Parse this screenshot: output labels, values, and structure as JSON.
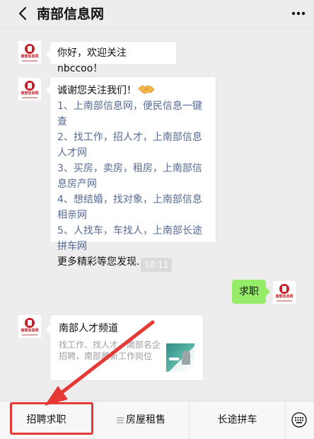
{
  "header": {
    "title": "南部信息网"
  },
  "account": {
    "avatar_line1": "南部信息网",
    "avatar_line2": ""
  },
  "messages": {
    "greeting": "你好，欢迎关注nbccoo！",
    "thanks_intro": "诚谢您关注我们！",
    "items": [
      "1、上南部信息网，便民信息一键查",
      "2、找工作，招人才，上南部信息人才网",
      "3、买房，卖房，租房，上南部信息房产网",
      "4、想结婚，找对象，上南部信息相亲网",
      "5、人找车，车找人，上南部长途拼车网"
    ],
    "more": "更多精彩等您发现..."
  },
  "timestamp": "10:11",
  "user_message": "求职",
  "card": {
    "title": "南部人才频道",
    "desc": "找工作、找人才，南部名企招聘，南部最新工作岗位"
  },
  "menu": {
    "item1": "招聘求职",
    "item2": "房屋租售",
    "item3": "长途拼车"
  },
  "colors": {
    "link": "#576b95",
    "user_bubble": "#95ec69",
    "annotation": "#e53935",
    "brand_red": "#c81e27"
  }
}
